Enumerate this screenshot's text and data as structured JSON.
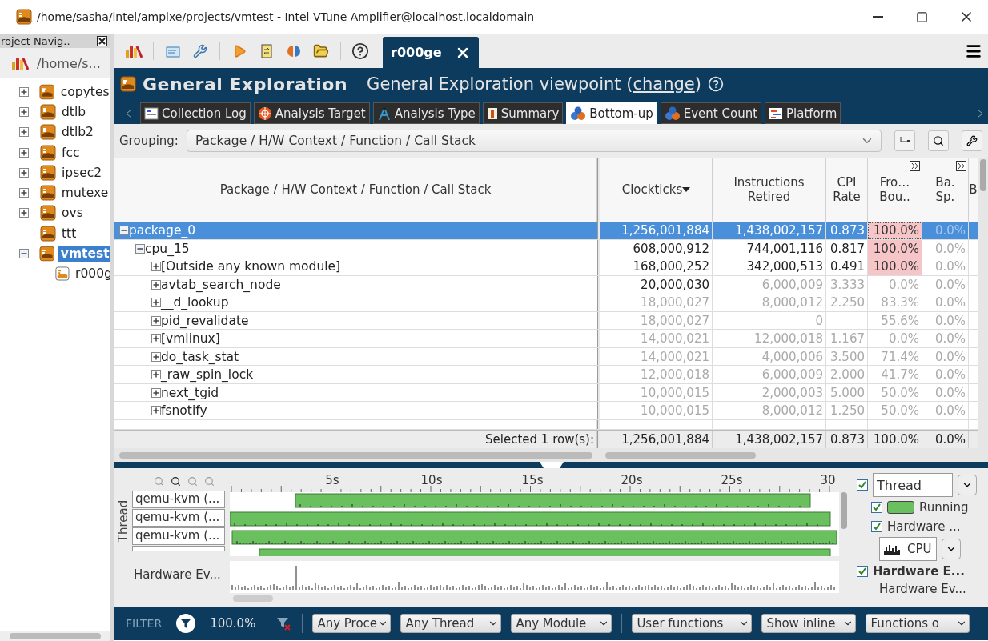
{
  "window": {
    "title": "/home/sasha/intel/amplxe/projects/vmtest - Intel VTune Amplifier@localhost.localdomain"
  },
  "navigator": {
    "title": "roject Navig..",
    "root": "/home/s...",
    "items": [
      {
        "label": "copytes",
        "kind": "project",
        "expandable": true,
        "expanded": false,
        "selected": false
      },
      {
        "label": "dtlb",
        "kind": "project",
        "expandable": true,
        "expanded": false,
        "selected": false
      },
      {
        "label": "dtlb2",
        "kind": "project",
        "expandable": true,
        "expanded": false,
        "selected": false
      },
      {
        "label": "fcc",
        "kind": "project",
        "expandable": true,
        "expanded": false,
        "selected": false
      },
      {
        "label": "ipsec2",
        "kind": "project",
        "expandable": true,
        "expanded": false,
        "selected": false
      },
      {
        "label": "mutexe",
        "kind": "project",
        "expandable": true,
        "expanded": false,
        "selected": false
      },
      {
        "label": "ovs",
        "kind": "project",
        "expandable": true,
        "expanded": false,
        "selected": false
      },
      {
        "label": "ttt",
        "kind": "project",
        "expandable": false,
        "selected": false
      },
      {
        "label": "vmtest",
        "kind": "project",
        "expandable": true,
        "expanded": true,
        "selected": true,
        "children": [
          {
            "label": "r000g",
            "kind": "result",
            "expandable": false,
            "selected": false
          }
        ]
      }
    ]
  },
  "document_tab": {
    "label": "r000ge"
  },
  "header": {
    "title": "General Exploration",
    "viewpoint": "General Exploration viewpoint (",
    "link": "change",
    "after": ")"
  },
  "tabs": [
    {
      "label": "Collection Log",
      "kind": "log",
      "selected": false
    },
    {
      "label": "Analysis Target",
      "kind": "target",
      "selected": false
    },
    {
      "label": "Analysis Type",
      "kind": "type",
      "selected": false
    },
    {
      "label": "Summary",
      "kind": "summary",
      "selected": false
    },
    {
      "label": "Bottom-up",
      "kind": "bottomup",
      "selected": true
    },
    {
      "label": "Event Count",
      "kind": "bottomup",
      "selected": false
    },
    {
      "label": "Platform",
      "kind": "platform",
      "selected": false
    }
  ],
  "grouping": {
    "label": "Grouping:",
    "value": "Package / H/W Context / Function / Call Stack"
  },
  "table": {
    "tree_column": {
      "label": "Package / H/W Context / Function / Call Stack"
    },
    "columns": [
      {
        "label": "Clockticks",
        "sorted": true,
        "expandable": false
      },
      {
        "label": "Instructions Retired",
        "sorted": false,
        "expandable": false
      },
      {
        "label": "CPI\nRate",
        "sorted": false,
        "expandable": false
      },
      {
        "label": "Fro…\nBou..",
        "sorted": false,
        "expandable": true
      },
      {
        "label": "Ba.\nSp.",
        "sorted": false,
        "expandable": true
      }
    ],
    "partial_column": {
      "label": "B"
    },
    "rows": [
      {
        "name": "package_0",
        "expanded": true,
        "selected": true,
        "cells": [
          {
            "text": "1,256,001,884",
            "muted": false,
            "flagged": false
          },
          {
            "text": "1,438,002,157",
            "muted": false,
            "flagged": false
          },
          {
            "text": "0.873",
            "muted": false,
            "flagged": false
          },
          {
            "text": "100.0%",
            "muted": false,
            "flagged": true
          },
          {
            "text": "0.0%",
            "muted": true,
            "flagged": false
          }
        ],
        "children": [
          {
            "name": "cpu_15",
            "expanded": true,
            "selected": false,
            "cells": [
              {
                "text": "608,000,912",
                "muted": false,
                "flagged": false
              },
              {
                "text": "744,001,116",
                "muted": false,
                "flagged": false
              },
              {
                "text": "0.817",
                "muted": false,
                "flagged": false
              },
              {
                "text": "100.0%",
                "muted": false,
                "flagged": true
              },
              {
                "text": "0.0%",
                "muted": true,
                "flagged": false
              }
            ],
            "children": [
              {
                "name": "[Outside any known module]",
                "expanded": false,
                "selected": false,
                "cells": [
                  {
                    "text": "168,000,252",
                    "muted": false,
                    "flagged": false
                  },
                  {
                    "text": "342,000,513",
                    "muted": false,
                    "flagged": false
                  },
                  {
                    "text": "0.491",
                    "muted": false,
                    "flagged": false
                  },
                  {
                    "text": "100.0%",
                    "muted": false,
                    "flagged": true
                  },
                  {
                    "text": "0.0%",
                    "muted": true,
                    "flagged": false
                  }
                ]
              },
              {
                "name": "avtab_search_node",
                "expanded": false,
                "selected": false,
                "cells": [
                  {
                    "text": "20,000,030",
                    "muted": false,
                    "flagged": false
                  },
                  {
                    "text": "6,000,009",
                    "muted": true,
                    "flagged": false
                  },
                  {
                    "text": "3.333",
                    "muted": true,
                    "flagged": false
                  },
                  {
                    "text": "0.0%",
                    "muted": true,
                    "flagged": false
                  },
                  {
                    "text": "0.0%",
                    "muted": true,
                    "flagged": false
                  }
                ]
              },
              {
                "name": "__d_lookup",
                "expanded": false,
                "selected": false,
                "cells": [
                  {
                    "text": "18,000,027",
                    "muted": true,
                    "flagged": false
                  },
                  {
                    "text": "8,000,012",
                    "muted": true,
                    "flagged": false
                  },
                  {
                    "text": "2.250",
                    "muted": true,
                    "flagged": false
                  },
                  {
                    "text": "83.3%",
                    "muted": true,
                    "flagged": false
                  },
                  {
                    "text": "0.0%",
                    "muted": true,
                    "flagged": false
                  }
                ]
              },
              {
                "name": "pid_revalidate",
                "expanded": false,
                "selected": false,
                "cells": [
                  {
                    "text": "18,000,027",
                    "muted": true,
                    "flagged": false
                  },
                  {
                    "text": "0",
                    "muted": true,
                    "flagged": false
                  },
                  {
                    "muted": true,
                    "flagged": false
                  },
                  {
                    "text": "55.6%",
                    "muted": true,
                    "flagged": false
                  },
                  {
                    "text": "0.0%",
                    "muted": true,
                    "flagged": false
                  }
                ]
              },
              {
                "name": "[vmlinux]",
                "expanded": false,
                "selected": false,
                "cells": [
                  {
                    "text": "14,000,021",
                    "muted": true,
                    "flagged": false
                  },
                  {
                    "text": "12,000,018",
                    "muted": true,
                    "flagged": false
                  },
                  {
                    "text": "1.167",
                    "muted": true,
                    "flagged": false
                  },
                  {
                    "text": "0.0%",
                    "muted": true,
                    "flagged": false
                  },
                  {
                    "text": "0.0%",
                    "muted": true,
                    "flagged": false
                  }
                ]
              },
              {
                "name": "do_task_stat",
                "expanded": false,
                "selected": false,
                "cells": [
                  {
                    "text": "14,000,021",
                    "muted": true,
                    "flagged": false
                  },
                  {
                    "text": "4,000,006",
                    "muted": true,
                    "flagged": false
                  },
                  {
                    "text": "3.500",
                    "muted": true,
                    "flagged": false
                  },
                  {
                    "text": "71.4%",
                    "muted": true,
                    "flagged": false
                  },
                  {
                    "text": "0.0%",
                    "muted": true,
                    "flagged": false
                  }
                ]
              },
              {
                "name": "_raw_spin_lock",
                "expanded": false,
                "selected": false,
                "cells": [
                  {
                    "text": "12,000,018",
                    "muted": true,
                    "flagged": false
                  },
                  {
                    "text": "6,000,009",
                    "muted": true,
                    "flagged": false
                  },
                  {
                    "text": "2.000",
                    "muted": true,
                    "flagged": false
                  },
                  {
                    "text": "41.7%",
                    "muted": true,
                    "flagged": false
                  },
                  {
                    "text": "0.0%",
                    "muted": true,
                    "flagged": false
                  }
                ]
              },
              {
                "name": "next_tgid",
                "expanded": false,
                "selected": false,
                "cells": [
                  {
                    "text": "10,000,015",
                    "muted": true,
                    "flagged": false
                  },
                  {
                    "text": "2,000,003",
                    "muted": true,
                    "flagged": false
                  },
                  {
                    "text": "5.000",
                    "muted": true,
                    "flagged": false
                  },
                  {
                    "text": "50.0%",
                    "muted": true,
                    "flagged": false
                  },
                  {
                    "text": "0.0%",
                    "muted": true,
                    "flagged": false
                  }
                ]
              },
              {
                "name": "fsnotify",
                "expanded": false,
                "selected": false,
                "cells": [
                  {
                    "text": "10,000,015",
                    "muted": true,
                    "flagged": false
                  },
                  {
                    "text": "8,000,012",
                    "muted": true,
                    "flagged": false
                  },
                  {
                    "text": "1.250",
                    "muted": true,
                    "flagged": false
                  },
                  {
                    "text": "50.0%",
                    "muted": true,
                    "flagged": false
                  },
                  {
                    "text": "0.0%",
                    "muted": true,
                    "flagged": false
                  }
                ]
              }
            ]
          }
        ]
      }
    ],
    "footer": {
      "label": "Selected 1 row(s):",
      "values": [
        "1,256,001,884",
        "1,438,002,157",
        "0.873",
        "100.0%",
        "0.0%"
      ]
    }
  },
  "timeline": {
    "axis_label": "Thread",
    "ticks": [
      "5s",
      "10s",
      "15s",
      "20s",
      "25s",
      "30"
    ],
    "threads": [
      "qemu-kvm (...",
      "qemu-kvm (...",
      "qemu-kvm (..."
    ],
    "hardware_label": "Hardware Ev..."
  },
  "legend": {
    "thread": {
      "checked": true,
      "value": "Thread"
    },
    "running": {
      "checked": true,
      "label": "Running",
      "color": "#6abf5e"
    },
    "hardware": {
      "checked": true,
      "label": "Hardware ..."
    },
    "metric": {
      "value": "CPU"
    },
    "hardware_events": {
      "checked": true,
      "label": "Hardware E..."
    },
    "hardware_note": "Hardware Ev..."
  },
  "filter_bar": {
    "label": "FILTER",
    "percent": "100.0%",
    "dropdowns": [
      "Any Proce",
      "Any Thread",
      "Any Module",
      "User functions",
      "Show inline",
      "Functions o"
    ]
  }
}
